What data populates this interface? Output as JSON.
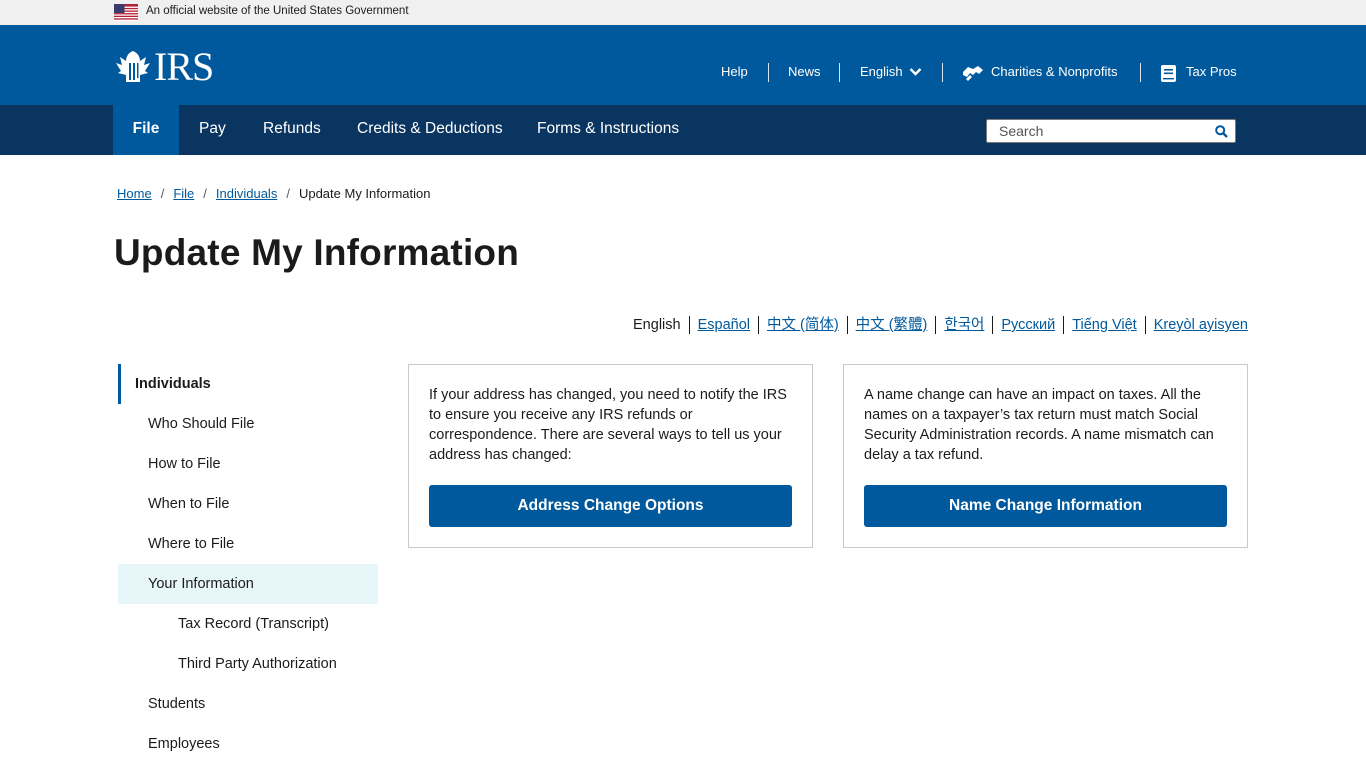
{
  "gov_banner": {
    "text": "An official website of the United States Government",
    "flag_icon": "us-flag-icon"
  },
  "header": {
    "logo_text": "IRS",
    "logo_icon": "irs-eagle-icon",
    "utility": {
      "help": "Help",
      "news": "News",
      "language": "English",
      "charities": "Charities & Nonprofits",
      "tax_pros": "Tax Pros"
    }
  },
  "nav": {
    "items": [
      {
        "label": "File",
        "active": true
      },
      {
        "label": "Pay"
      },
      {
        "label": "Refunds"
      },
      {
        "label": "Credits & Deductions"
      },
      {
        "label": "Forms & Instructions"
      }
    ],
    "search_placeholder": "Search"
  },
  "breadcrumb": {
    "items": [
      "Home",
      "File",
      "Individuals"
    ],
    "current": "Update My Information"
  },
  "page_title": "Update My Information",
  "languages": {
    "current": "English",
    "links": [
      "Español",
      "中文 (简体)",
      "中文 (繁體)",
      "한국어",
      "Русский",
      "Tiếng Việt",
      "Kreyòl ayisyen"
    ]
  },
  "sidebar": {
    "parent": "Individuals",
    "items": [
      "Who Should File",
      "How to File",
      "When to File",
      "Where to File",
      "Your Information",
      "Tax Record (Transcript)",
      "Third Party Authorization",
      "Students",
      "Employees"
    ]
  },
  "cards": [
    {
      "text": "If your address has changed, you need to notify the IRS to ensure you receive any IRS refunds or correspondence. There are several ways to tell us your address has changed:",
      "button": "Address Change Options"
    },
    {
      "text": "A name change can have an impact on taxes. All the names on a taxpayer’s tax return must match Social Security Administration records. A name mismatch can delay a tax refund.",
      "button": "Name Change Information"
    }
  ],
  "colors": {
    "primary": "#00599c",
    "nav": "#0a3560",
    "highlight": "#e7f6f8"
  }
}
